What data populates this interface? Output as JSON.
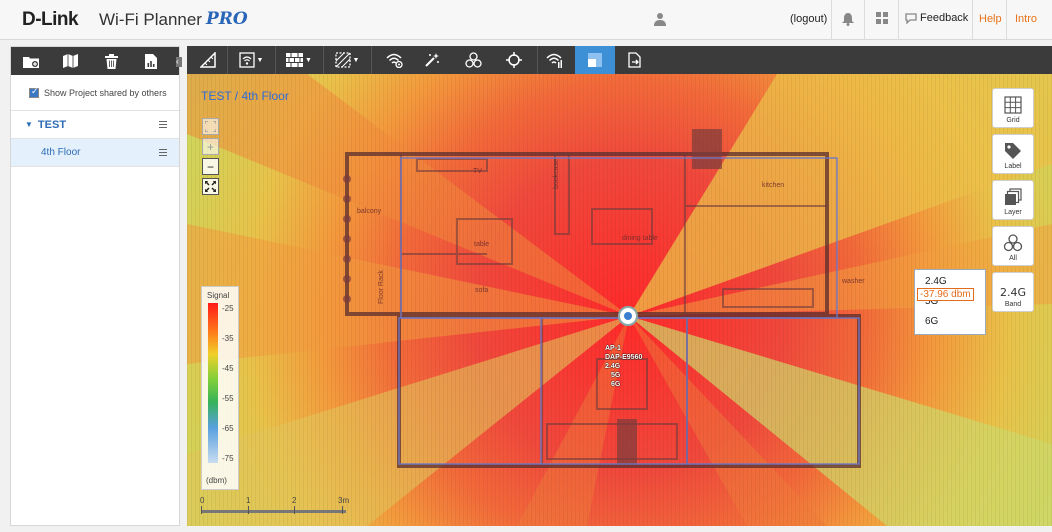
{
  "header": {
    "brand": "D-Link",
    "product": "Wi-Fi Planner",
    "edition": "PRO",
    "logout": "(logout)",
    "feedback": "Feedback",
    "help": "Help",
    "intro": "Intro"
  },
  "sidebar": {
    "show_shared_label": "Show Project shared by others",
    "show_shared_checked": true,
    "project": "TEST",
    "floor": "4th Floor"
  },
  "canvas": {
    "breadcrumb": "TEST / 4th Floor",
    "legend": {
      "title": "Signal",
      "ticks": [
        "-25",
        "-35",
        "-45",
        "-55",
        "-65",
        "-75"
      ],
      "unit": "(dbm)"
    },
    "scale": {
      "ticks": [
        "0",
        "1",
        "2",
        "3m"
      ]
    },
    "room_labels": [
      "TV",
      "bookcase",
      "kitchen",
      "balcony",
      "table",
      "dining table",
      "sofa",
      "Floor Rack",
      "washer"
    ],
    "ap": {
      "line1": "AP-1",
      "line2": "DAP-E9560",
      "line3": "2.4G",
      "line4": "5G",
      "line5": "6G"
    }
  },
  "right_tools": {
    "grid": "Grid",
    "label": "Label",
    "layer": "Layer",
    "all": "All",
    "band_icon_text": "2.4G",
    "band": "Band"
  },
  "band_popup": {
    "option1": "2.4G",
    "value": "-37.96 dbm",
    "option2": "5G",
    "option3": "6G"
  },
  "colors": {
    "toolbar_bg": "#3b3b3b",
    "active_tool": "#3d8fd6",
    "accent_orange": "#e8731a",
    "link_blue": "#2d6cb5",
    "heat_red": "#e74a3e"
  }
}
